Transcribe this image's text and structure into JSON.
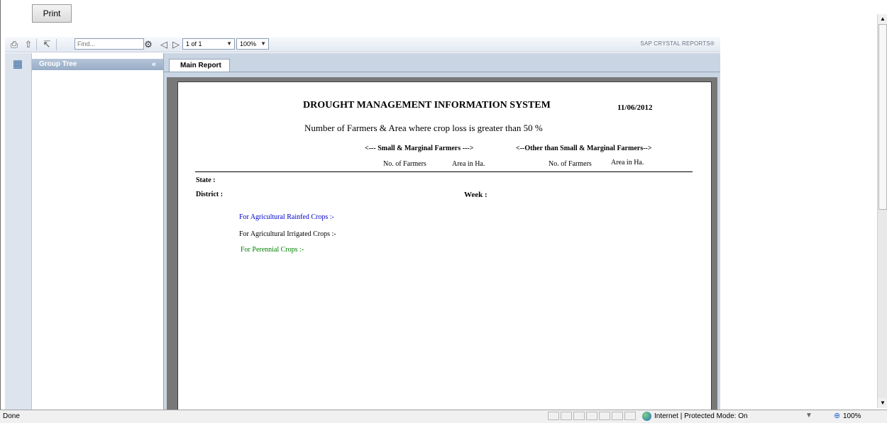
{
  "top": {
    "print_label": "Print"
  },
  "toolbar": {
    "find_placeholder": "Find...",
    "page_value": "1 of 1",
    "zoom_value": "100%",
    "brand": "SAP CRYSTAL REPORTS®",
    "icons": [
      "print-icon",
      "export-icon",
      "refresh-icon",
      "binoculars-icon",
      "prev-page-icon",
      "next-page-icon"
    ]
  },
  "sidebar": {
    "group_tree_title": "Group Tree",
    "collapse_glyph": "«",
    "toggle_icon": "group-tree-toggle-icon"
  },
  "main": {
    "tab_label": "Main Report"
  },
  "report": {
    "title": "DROUGHT MANAGEMENT INFORMATION SYSTEM",
    "date": "11/06/2012",
    "subtitle": "Number of Farmers & Area where crop loss is greater than 50 %",
    "header_small": "<--- Small & Marginal Farmers --->",
    "header_other": "<--Other than Small & Marginal Farmers-->",
    "columns": [
      "No. of Farmers",
      "Area in Ha.",
      "No. of Farmers",
      "Area in Ha."
    ],
    "state_label": "State :",
    "district_label": "District :",
    "week_label": "Week :",
    "rainfed_label": "For Agricultural Rainfed Crops :-",
    "irrigated_label": "For Agricultural Irrigated Crops :-",
    "perennial_label": "For Perennial Crops :-",
    "colors": {
      "rainfed": "#0000cc",
      "irrigated": "#000000",
      "perennial": "#008000"
    }
  },
  "statusbar": {
    "status": "Done",
    "zone": "Internet | Protected Mode: On",
    "zoom": "100%"
  }
}
